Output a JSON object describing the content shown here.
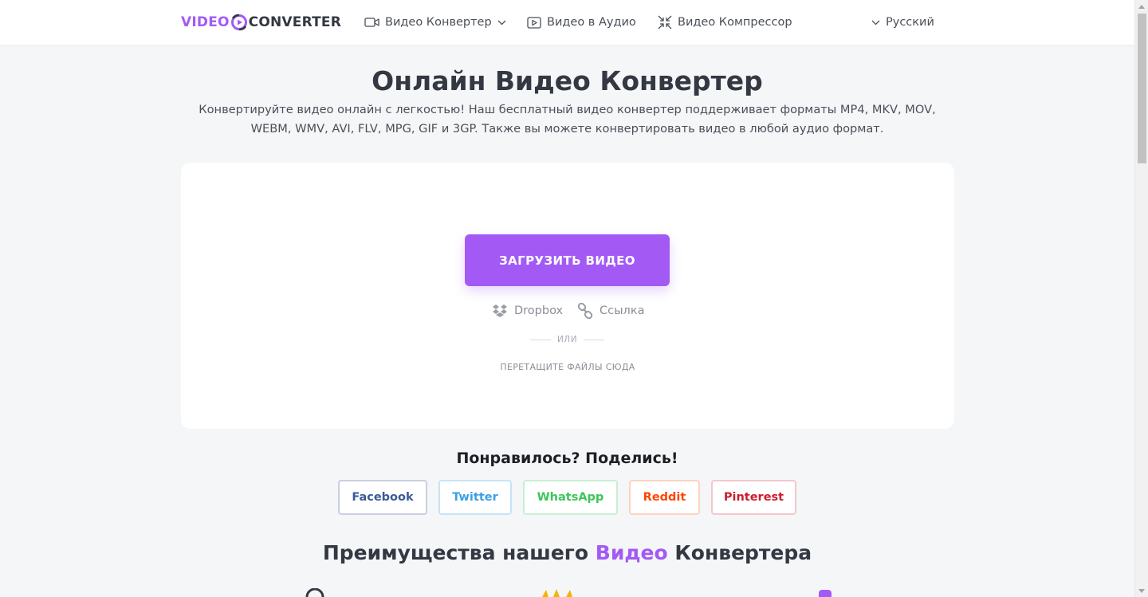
{
  "header": {
    "logo": {
      "word1": "VIDEO",
      "word2": "CONVERTER"
    },
    "nav": [
      {
        "label": "Видео Конвертер",
        "icon": "video-camera-icon",
        "has_dropdown": true
      },
      {
        "label": "Видео в Аудио",
        "icon": "play-box-icon",
        "has_dropdown": false
      },
      {
        "label": "Видео Компрессор",
        "icon": "compress-arrows-icon",
        "has_dropdown": false
      }
    ],
    "language": "Русский"
  },
  "main": {
    "title": "Онлайн Видео Конвертер",
    "subtitle_line1": "Конвертируйте видео онлайн с легкостью! Наш бесплатный видео конвертер поддерживает форматы MP4, MKV, MOV,",
    "subtitle_line2": "WEBM, WMV, AVI, FLV, MPG, GIF и 3GP. Также вы можете конвертировать видео в любой аудио формат."
  },
  "upload": {
    "button": "ЗАГРУЗИТЬ ВИДЕО",
    "dropbox": "Dropbox",
    "link": "Ссылка",
    "or": "ИЛИ",
    "drop_hint": "ПЕРЕТАЩИТЕ ФАЙЛЫ СЮДА"
  },
  "share": {
    "title": "Понравилось? Поделись!",
    "buttons": [
      {
        "label": "Facebook",
        "color": "#3b5998",
        "border": "#c9cfe0"
      },
      {
        "label": "Twitter",
        "color": "#3aa0e6",
        "border": "#c6e3f6"
      },
      {
        "label": "WhatsApp",
        "color": "#3cc65a",
        "border": "#c8efd3"
      },
      {
        "label": "Reddit",
        "color": "#ff4500",
        "border": "#ffd2c0"
      },
      {
        "label": "Pinterest",
        "color": "#cc1d2c",
        "border": "#f5c6cb"
      }
    ]
  },
  "advantages": {
    "part1": "Преимущества нашего ",
    "accent": "Видео",
    "part2": " Конвертера"
  },
  "colors": {
    "accent": "#a35af5",
    "text": "#333842",
    "background": "#f5f6f8"
  }
}
